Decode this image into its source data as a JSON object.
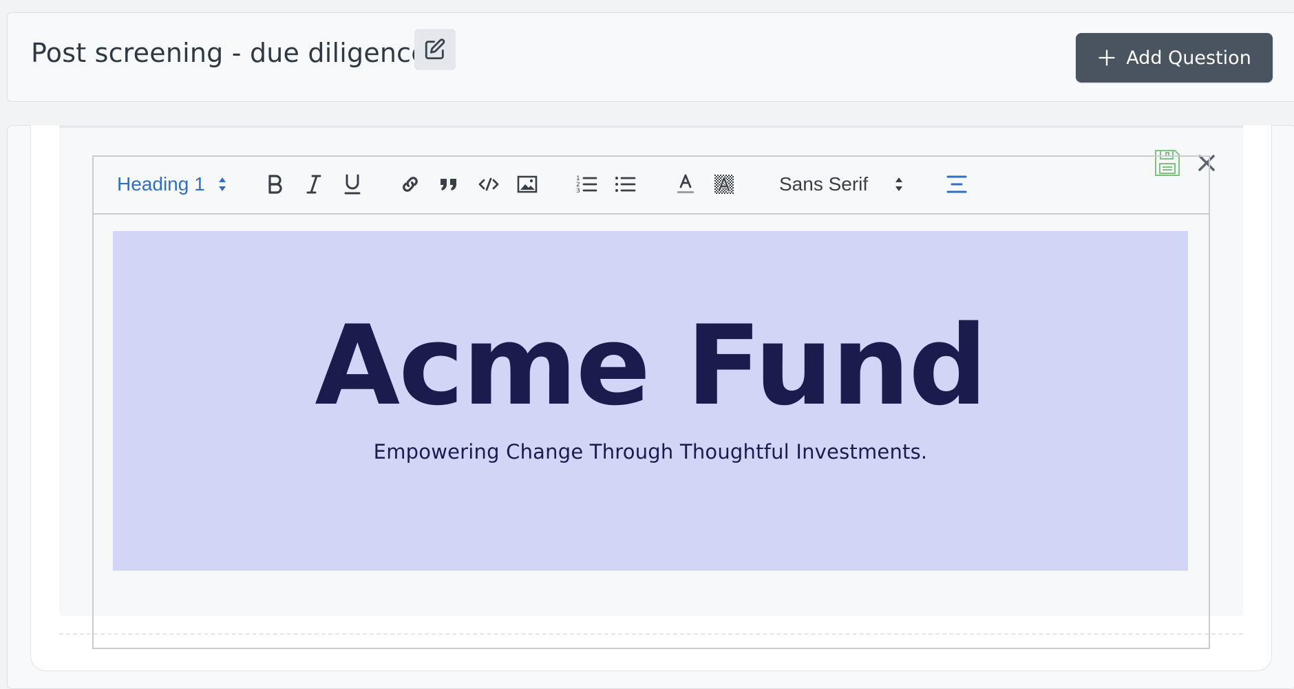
{
  "header": {
    "title": "Post screening - due diligence",
    "add_question_label": "Add Question"
  },
  "editor": {
    "toolbar": {
      "heading_select": "Heading 1",
      "font_select": "Sans Serif",
      "buttons": [
        "bold",
        "italic",
        "underline",
        "link",
        "blockquote",
        "code-block",
        "image",
        "ordered-list",
        "bullet-list",
        "text-color",
        "background-color",
        "align-center"
      ]
    },
    "banner": {
      "title": "Acme Fund",
      "subtitle": "Empowering Change Through Thoughtful Investments."
    }
  },
  "colors": {
    "primary_button": "#4a5360",
    "toolbar_active": "#2f6fc4",
    "banner_bg": "#d3d5f7",
    "banner_text": "#1b1b4e",
    "save_icon": "#7cc47a"
  },
  "icons": [
    "edit-icon",
    "plus-icon",
    "save-icon",
    "close-icon",
    "select-arrows-icon"
  ]
}
